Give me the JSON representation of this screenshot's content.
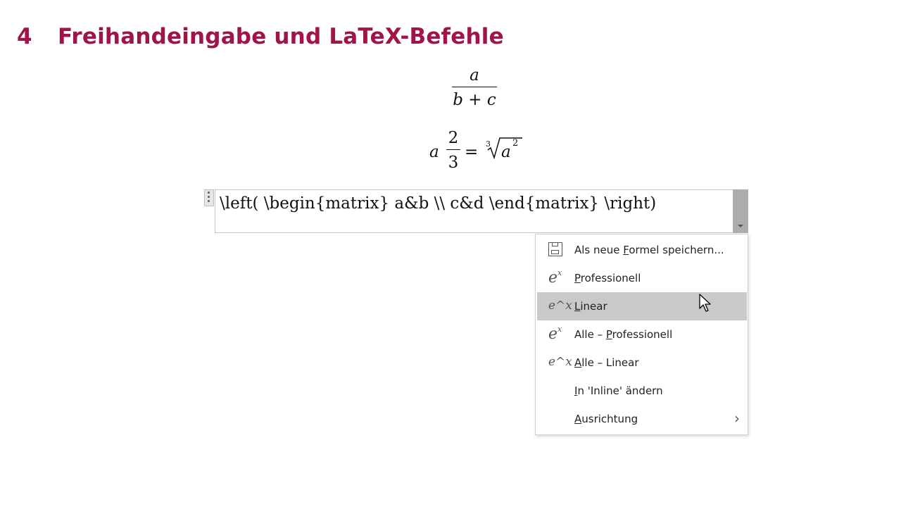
{
  "heading": {
    "number": "4",
    "title": "Freihandeingabe und LaTeX-Befehle"
  },
  "equation1": {
    "numerator": "a",
    "denominator": "b + c"
  },
  "equation2": {
    "whole": "a",
    "frac_num": "2",
    "frac_den": "3",
    "equals": "=",
    "root_index": "3",
    "radicand": "a",
    "exponent": "2"
  },
  "equation_input": {
    "value": "\\left( \\begin{matrix} a&b \\\\ c&d \\end{matrix} \\right)"
  },
  "context_menu": {
    "items": [
      {
        "pre": "Als neue ",
        "key": "F",
        "post": "ormel speichern...",
        "icon": "save-icon"
      },
      {
        "pre": "",
        "key": "P",
        "post": "rofessionell",
        "icon": "professional-format-icon"
      },
      {
        "pre": "",
        "key": "L",
        "post": "inear",
        "icon": "linear-format-icon",
        "highlighted": true
      },
      {
        "pre": "Alle – ",
        "key": "P",
        "post": "rofessionell",
        "icon": "professional-format-icon"
      },
      {
        "pre": "",
        "key": "A",
        "post": "lle – Linear",
        "icon": "linear-format-icon"
      },
      {
        "pre": "",
        "key": "I",
        "post": "n 'Inline' ändern",
        "icon": ""
      },
      {
        "pre": "",
        "key": "A",
        "post": "usrichtung",
        "icon": "",
        "submenu": true
      }
    ]
  },
  "icons": {
    "professional_base": "e",
    "professional_sup": "x",
    "linear": "e^x",
    "submenu": "›"
  },
  "colors": {
    "heading": "#a0144a",
    "highlight": "#c9c9c9",
    "dropdown": "#adadad"
  }
}
